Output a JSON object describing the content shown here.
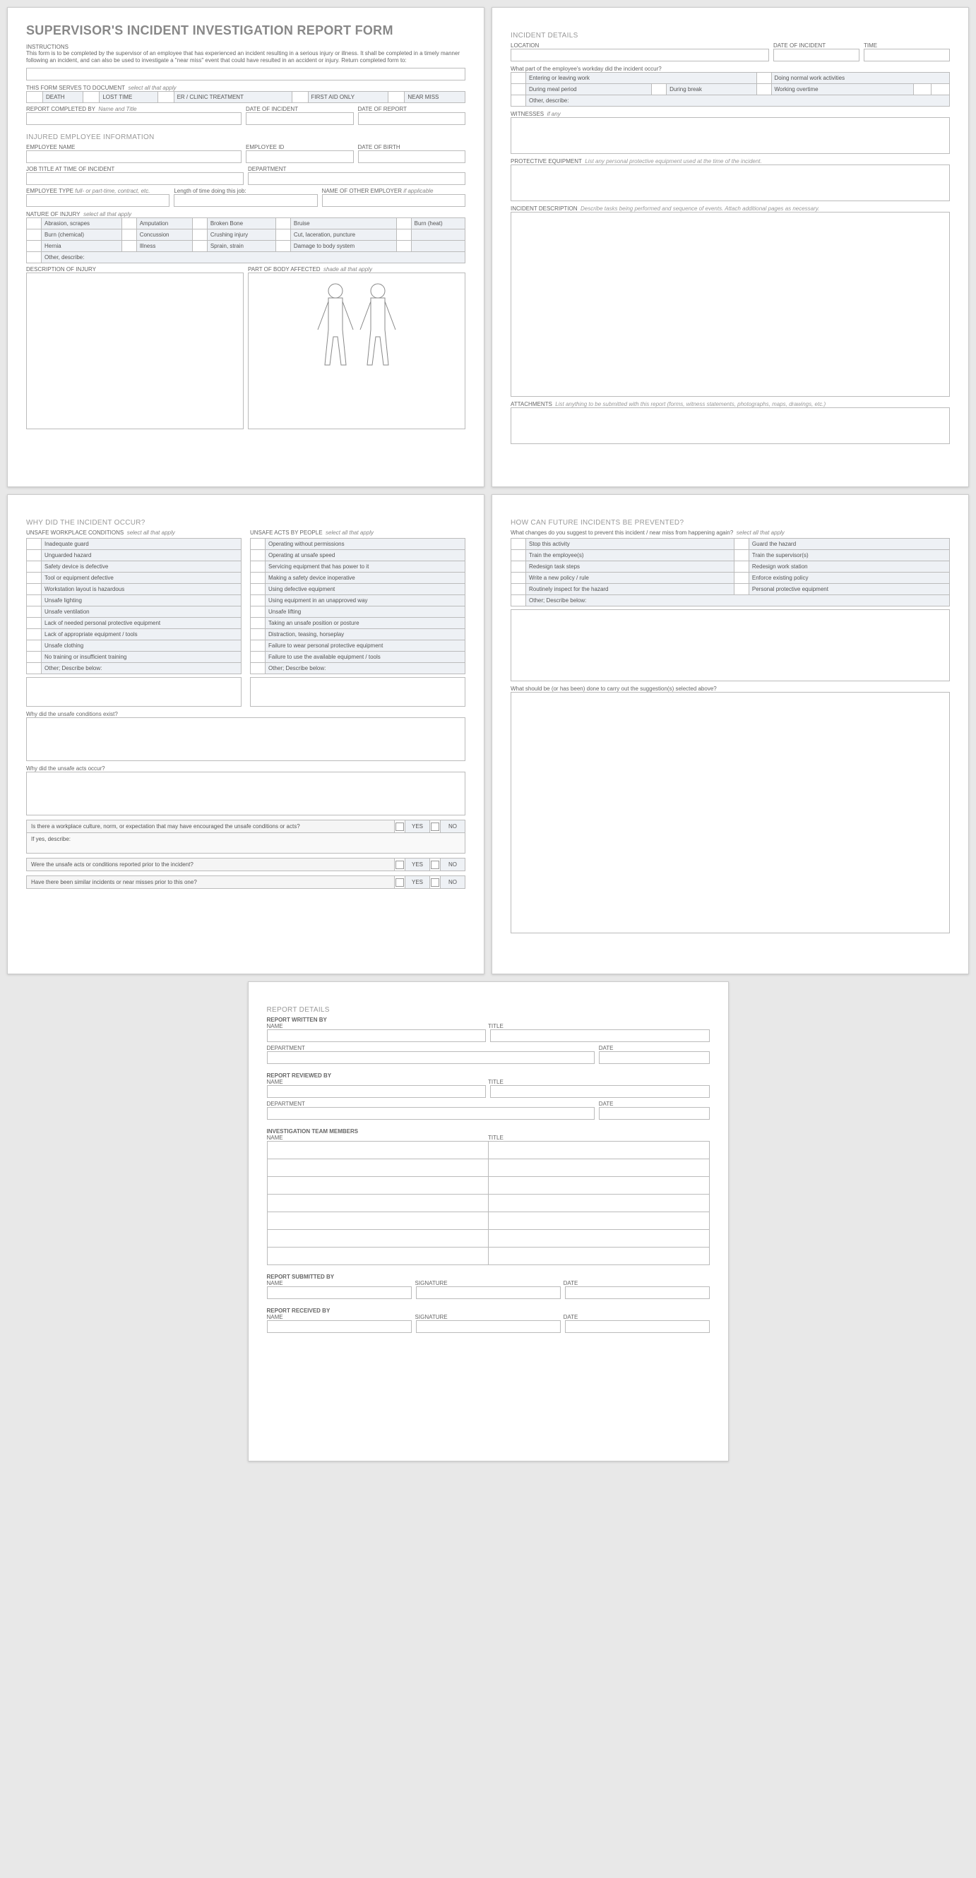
{
  "title": "SUPERVISOR'S INCIDENT INVESTIGATION REPORT FORM",
  "instructions_head": "INSTRUCTIONS",
  "instructions_text": "This form is to be completed by the supervisor of an employee that has experienced an incident resulting in a serious injury or illness. It shall be completed in a timely manner following an incident, and can also be used to investigate a \"near miss\" event that could have resulted in an accident or injury. Return completed form to:",
  "doc_serves_label": "THIS FORM SERVES TO DOCUMENT",
  "select_all": "select all that apply",
  "doc_serves_opts": [
    "DEATH",
    "LOST TIME",
    "ER / CLINIC TREATMENT",
    "FIRST AID ONLY",
    "NEAR MISS"
  ],
  "report_completed_by": "REPORT COMPLETED BY",
  "name_title_note": "Name and Title",
  "date_of_incident": "DATE OF INCIDENT",
  "date_of_report": "DATE OF REPORT",
  "injured_emp_head": "INJURED EMPLOYEE INFORMATION",
  "emp_name": "EMPLOYEE NAME",
  "emp_id": "EMPLOYEE ID",
  "dob": "DATE OF BIRTH",
  "job_title": "JOB TITLE AT TIME OF INCIDENT",
  "department": "DEPARTMENT",
  "emp_type": "EMPLOYEE TYPE",
  "emp_type_note": "full- or part-time, contract, etc.",
  "time_in_job": "Length of time doing this job:",
  "other_employer": "NAME OF OTHER EMPLOYER",
  "if_applicable": "if applicable",
  "nature_of_injury": "NATURE OF INJURY",
  "injury_opts": [
    [
      "Abrasion, scrapes",
      "Amputation",
      "Broken Bone",
      "Bruise",
      "Burn (heat)"
    ],
    [
      "Burn (chemical)",
      "Concussion",
      "Crushing injury",
      "Cut, laceration, puncture",
      ""
    ],
    [
      "Hernia",
      "Illness",
      "Sprain, strain",
      "Damage to body system",
      ""
    ]
  ],
  "other_describe": "Other, describe:",
  "desc_of_injury": "DESCRIPTION OF INJURY",
  "body_part": "PART OF BODY AFFECTED",
  "shade_note": "shade all that apply",
  "incident_details_head": "INCIDENT DETAILS",
  "location": "LOCATION",
  "time": "TIME",
  "workday_q": "What part of the employee's workday did the incident occur?",
  "workday_row1": [
    "Entering or leaving work",
    "Doing normal work activities"
  ],
  "workday_row2": [
    "During meal period",
    "During break",
    "Working overtime"
  ],
  "witnesses": "WITNESSES",
  "if_any": "if any",
  "ppe": "PROTECTIVE EQUIPMENT",
  "ppe_note": "List any personal protective equipment used at the time of the incident.",
  "incident_desc": "INCIDENT DESCRIPTION",
  "incident_desc_note": "Describe tasks being performed and sequence of events.  Attach additional pages as necessary.",
  "attachments": "ATTACHMENTS",
  "attachments_note": "List anything to be submitted with this report (forms, witness statements, photographs, maps, drawings, etc.)",
  "why_head": "WHY DID THE INCIDENT OCCUR?",
  "unsafe_cond_head": "UNSAFE WORKPLACE CONDITIONS",
  "unsafe_acts_head": "UNSAFE ACTS BY PEOPLE",
  "unsafe_cond": [
    "Inadequate guard",
    "Unguarded hazard",
    "Safety device is defective",
    "Tool or equipment defective",
    "Workstation layout is hazardous",
    "Unsafe lighting",
    "Unsafe ventilation",
    "Lack of needed personal protective equipment",
    "Lack of appropriate equipment / tools",
    "Unsafe clothing",
    "No training or insufficient training",
    "Other; Describe below:"
  ],
  "unsafe_acts": [
    "Operating without permissions",
    "Operating at unsafe speed",
    "Servicing equipment that has power to it",
    "Making a safety device inoperative",
    "Using defective equipment",
    "Using equipment in an unapproved way",
    "Unsafe lifting",
    "Taking an unsafe position or posture",
    "Distraction, teasing, horseplay",
    "Failure to wear personal protective equipment",
    "Failure to use the available equipment / tools",
    "Other; Describe below:"
  ],
  "why_cond_exist": "Why did the unsafe conditions exist?",
  "why_acts_occur": "Why did the unsafe acts occur?",
  "culture_q": "Is there a workplace culture, norm, or expectation that may have encouraged the unsafe conditions or acts?",
  "ifyes": "If yes, describe:",
  "reported_prior_q": "Were the unsafe acts or conditions reported prior to the incident?",
  "similar_q": "Have there been similar incidents or near misses prior to this one?",
  "yes": "YES",
  "no": "NO",
  "prevent_head": "HOW CAN FUTURE INCIDENTS BE PREVENTED?",
  "prevent_q": "What changes do you suggest to prevent this incident / near miss from happening again?",
  "prevent_opts": [
    [
      "Stop this activity",
      "Guard the hazard"
    ],
    [
      "Train the employee(s)",
      "Train the supervisor(s)"
    ],
    [
      "Redesign task steps",
      "Redesign work station"
    ],
    [
      "Write a new policy / rule",
      "Enforce existing policy"
    ],
    [
      "Routinely inspect for the hazard",
      "Personal protective equipment"
    ]
  ],
  "other_describe_below": "Other; Describe below:",
  "carryout_q": "What should be (or has been) done to carry out the suggestion(s) selected above?",
  "report_details_head": "REPORT DETAILS",
  "written_by": "REPORT WRITTEN BY",
  "name": "NAME",
  "title_lbl": "TITLE",
  "dept_lbl": "DEPARTMENT",
  "date_lbl": "DATE",
  "reviewed_by": "REPORT REVIEWED BY",
  "team_members": "INVESTIGATION TEAM MEMBERS",
  "submitted_by": "REPORT SUBMITTED BY",
  "signature": "SIGNATURE",
  "received_by": "REPORT RECEIVED BY"
}
